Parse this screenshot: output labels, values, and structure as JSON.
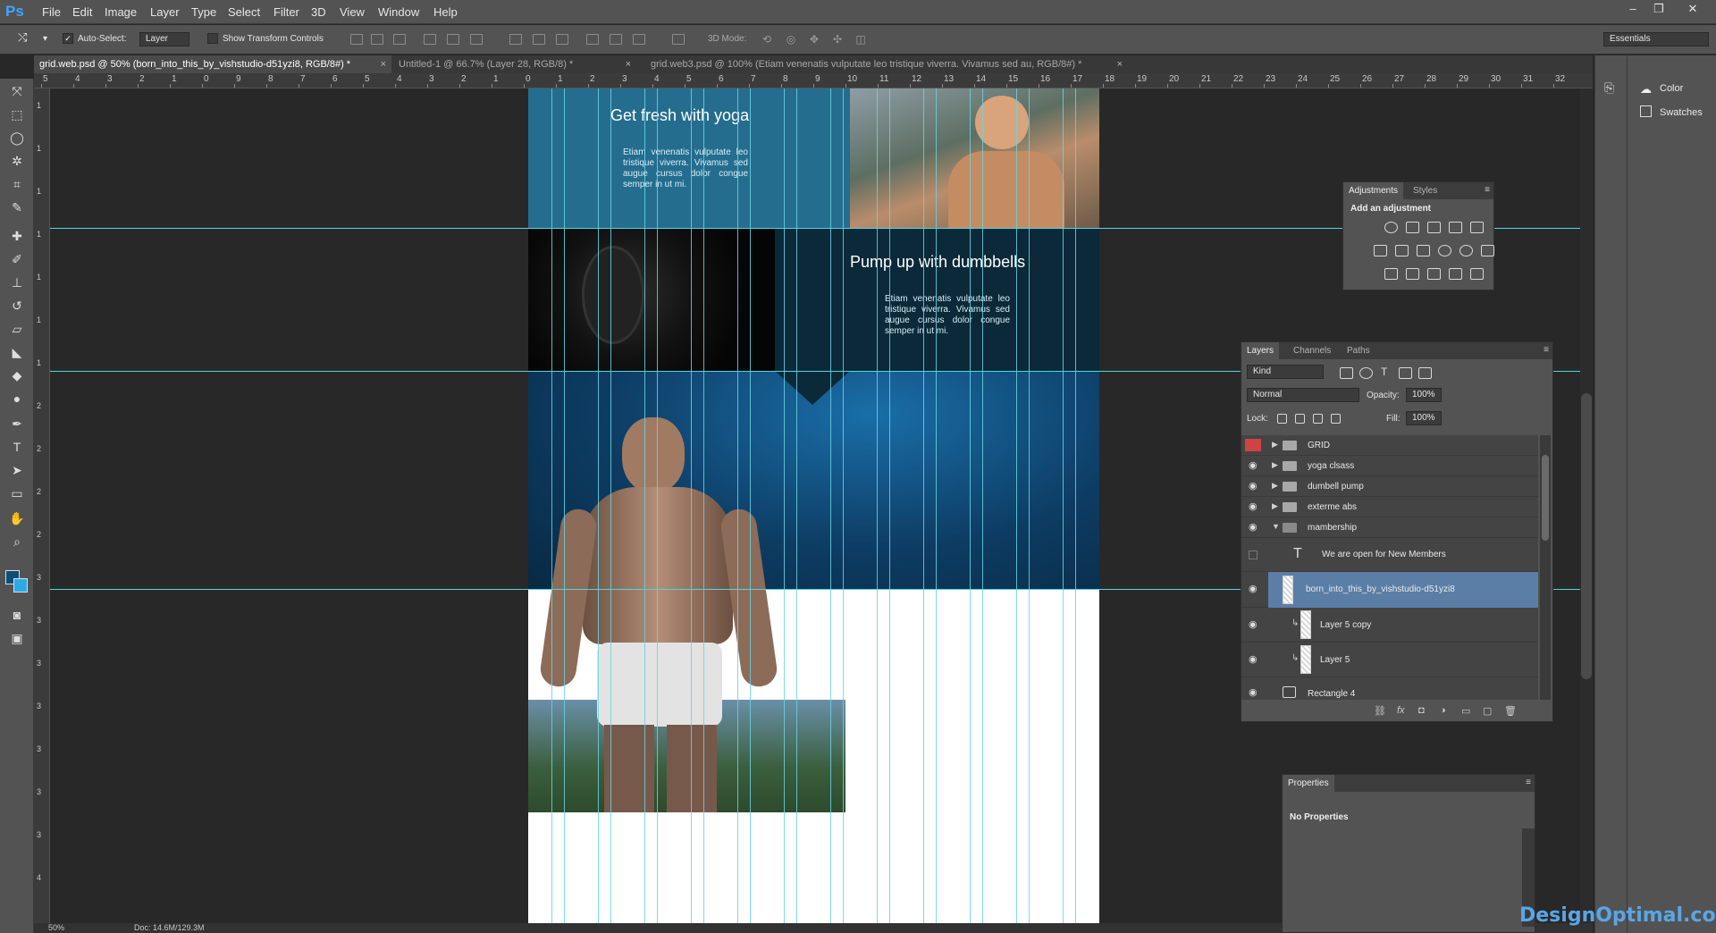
{
  "app": {
    "logo": "Ps"
  },
  "menu": [
    "File",
    "Edit",
    "Image",
    "Layer",
    "Type",
    "Select",
    "Filter",
    "3D",
    "View",
    "Window",
    "Help"
  ],
  "options": {
    "auto_select_label": "Auto-Select:",
    "auto_select_value": "Layer",
    "show_transform_label": "Show Transform Controls",
    "mode_label": "3D Mode:",
    "workspace": "Essentials"
  },
  "tabs": [
    {
      "label": "grid.web.psd @ 50% (born_into_this_by_vishstudio-d51yzi8, RGB/8#) *"
    },
    {
      "label": "Untitled-1 @ 66.7% (Layer 28, RGB/8) *"
    },
    {
      "label": "grid.web3.psd @ 100% (Etiam venenatis vulputate leo tristique viverra. Vivamus sed au, RGB/8#) *"
    }
  ],
  "ruler": {
    "top": [
      "5",
      "4",
      "3",
      "2",
      "1",
      "0",
      "9",
      "8",
      "7",
      "6",
      "5",
      "4",
      "3",
      "2",
      "1",
      "0",
      "1",
      "2",
      "3",
      "4",
      "5",
      "6",
      "7",
      "8",
      "9",
      "10",
      "11",
      "12",
      "13",
      "14",
      "15",
      "16",
      "17",
      "18",
      "19",
      "20",
      "21",
      "22",
      "23",
      "24",
      "25",
      "26",
      "27",
      "28",
      "29",
      "30",
      "31",
      "32"
    ],
    "left": [
      "1",
      "1",
      "1",
      "1",
      "1",
      "1",
      "1",
      "2",
      "2",
      "2",
      "2",
      "3",
      "3",
      "3",
      "3",
      "3",
      "3",
      "3",
      "4"
    ]
  },
  "design": {
    "yoga_title": "Get fresh with yoga",
    "yoga_body": "Etiam venenatis vulputate leo tristique viverra. Vivamus sed augue cursus dolor congue semper in ut mi.",
    "dumbbell_title": "Pump up with dumbbells",
    "dumbbell_body": "Etiam venenatis vulputate leo tristique viverra. Vivamus sed augue cursus dolor congue semper in ut mi."
  },
  "side_panel": {
    "color": "Color",
    "swatches": "Swatches"
  },
  "adjustments": {
    "tabs": [
      "Adjustments",
      "Styles"
    ],
    "heading": "Add an adjustment"
  },
  "layers": {
    "tabs": [
      "Layers",
      "Channels",
      "Paths"
    ],
    "filter": "Kind",
    "blend": "Normal",
    "opacity_label": "Opacity:",
    "opacity_value": "100%",
    "lock_label": "Lock:",
    "fill_label": "Fill:",
    "fill_value": "100%",
    "items": [
      {
        "name": "GRID"
      },
      {
        "name": "yoga clsass"
      },
      {
        "name": "dumbell pump"
      },
      {
        "name": "exterme abs"
      },
      {
        "name": "mambership"
      },
      {
        "name": "We are open for New Members"
      },
      {
        "name": "born_into_this_by_vishstudio-d51yzi8"
      },
      {
        "name": "Layer 5 copy"
      },
      {
        "name": "Layer 5"
      },
      {
        "name": "Rectangle 4"
      }
    ]
  },
  "properties": {
    "tab": "Properties",
    "message": "No Properties"
  },
  "status": {
    "zoom": "50%",
    "doc": "Doc: 14.6M/129.3M"
  },
  "watermark": "DesignOptimal.com",
  "colors": {
    "accent": "#3fa5ff",
    "guide": "#4fd6e3",
    "selected_layer": "#5b7ea6"
  }
}
